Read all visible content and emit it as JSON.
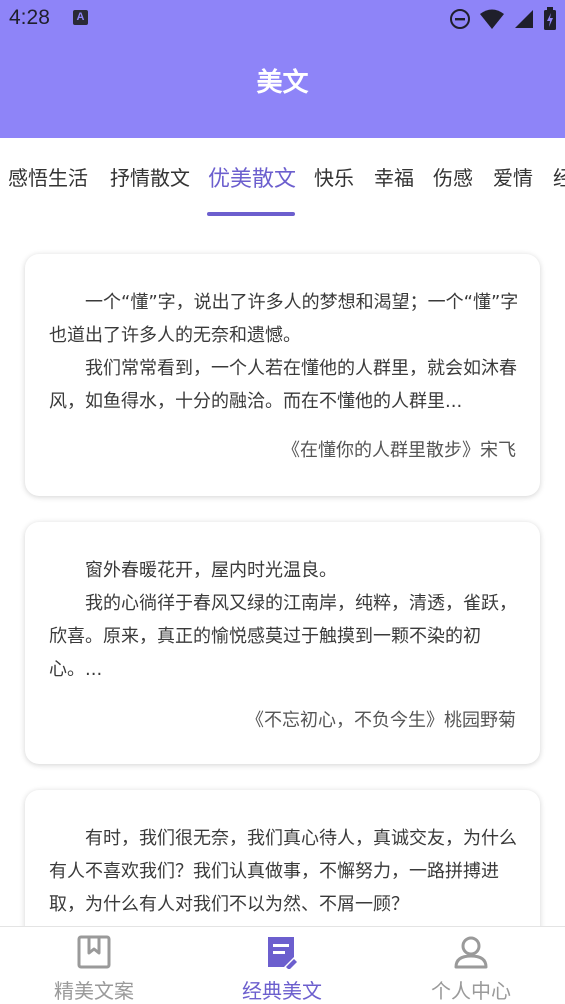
{
  "status": {
    "time": "4:28",
    "app_badge": "A"
  },
  "header": {
    "title": "美文"
  },
  "tabs": [
    {
      "label": "感悟生活"
    },
    {
      "label": "抒情散文"
    },
    {
      "label": "优美散文"
    },
    {
      "label": "快乐"
    },
    {
      "label": "幸福"
    },
    {
      "label": "伤感"
    },
    {
      "label": "爱情"
    },
    {
      "label": "经"
    }
  ],
  "active_tab": "优美散文",
  "articles": [
    {
      "lines": [
        "一个“懂”字，说出了许多人的梦想和渴望；一个“懂”字也道出了许多人的无奈和遗憾。",
        "我们常常看到，一个人若在懂他的人群里，就会如沐春风，如鱼得水，十分的融洽。而在不懂他的人群里..."
      ],
      "source": "《在懂你的人群里散步》宋飞"
    },
    {
      "lines": [
        "窗外春暖花开，屋内时光温良。",
        "我的心徜徉于春风又绿的江南岸，纯粹，清透，雀跃，欣喜。原来，真正的愉悦感莫过于触摸到一颗不染的初心。..."
      ],
      "source": "《不忘初心，不负今生》桃园野菊"
    },
    {
      "lines": [
        "有时，我们很无奈，我们真心待人，真诚交友，为什么有人不喜欢我们？我们认真做事，不懈努力，一路拼搏进取，为什么有人对我们不以为然、不屑一顾？"
      ],
      "source": ""
    }
  ],
  "bottom_nav": [
    {
      "label": "精美文案",
      "icon": "bookmark-icon"
    },
    {
      "label": "经典美文",
      "icon": "notes-icon"
    },
    {
      "label": "个人中心",
      "icon": "person-icon"
    }
  ],
  "active_nav": "经典美文",
  "colors": {
    "header": "#8e84f8",
    "accent": "#6c5fce",
    "inactive": "#9a9a9a"
  }
}
